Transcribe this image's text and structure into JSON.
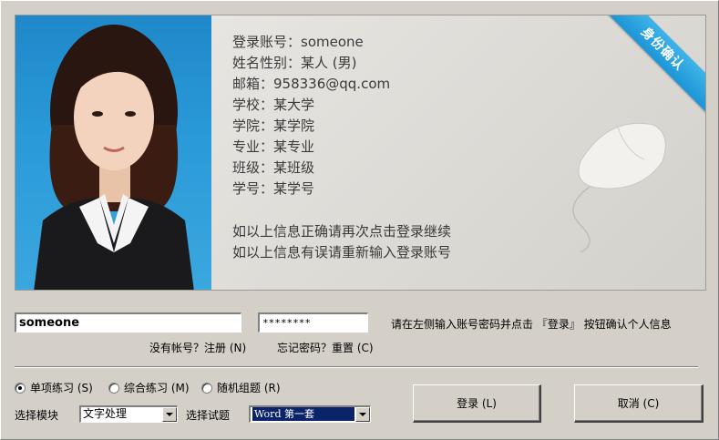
{
  "profile": {
    "account": "登录账号：someone",
    "name_gender": "姓名性别：某人 (男)",
    "email": "邮箱：958336@qq.com",
    "school": "学校：某大学",
    "college": "学院：某学院",
    "major": "专业：某专业",
    "class": "班级：某班级",
    "student_id": "学号：某学号",
    "notice_correct": "如以上信息正确请再次点击登录继续",
    "notice_wrong": "如以上信息有误请重新输入登录账号",
    "badge": "身份确认"
  },
  "login": {
    "account_value": "someone",
    "password_value": "********",
    "hint": "请在左侧输入账号密码并点击 『登录』 按钮确认个人信息",
    "register_link": "没有帐号？注册 (N)",
    "forgot_link": "忘记密码？重置 (C)"
  },
  "mode": {
    "options": [
      "单项练习 (S)",
      "综合练习 (M)",
      "随机组题 (R)"
    ],
    "selected": "单项练习 (S)"
  },
  "selectors": {
    "module_label": "选择模块",
    "module_value": "文字处理",
    "exam_label": "选择试题",
    "exam_value": "Word 第一套"
  },
  "buttons": {
    "login": "登录 (L)",
    "cancel": "取消 (C)"
  },
  "colors": {
    "window_bg": "#d4d0c8",
    "photo_bg": "#2a9ad8",
    "badge_bg": "#2aa5e0",
    "selection": "#0a246a"
  }
}
